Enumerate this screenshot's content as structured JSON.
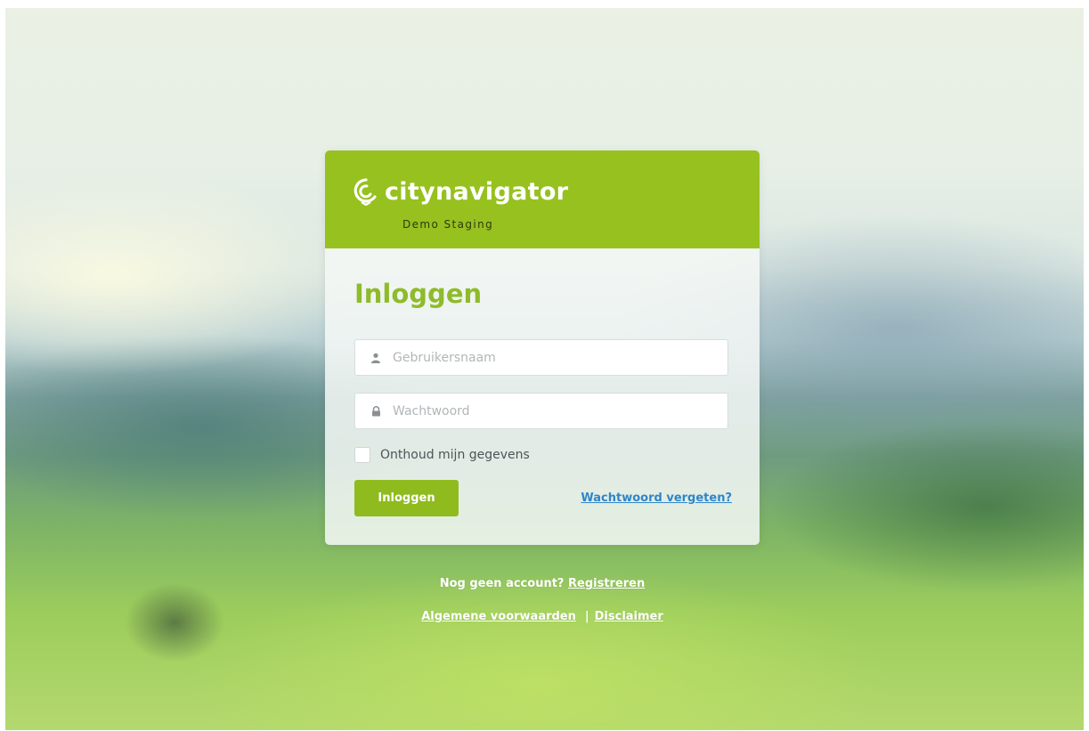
{
  "brand": {
    "name": "citynavigator",
    "subtitle": "Demo Staging",
    "icon": "citynavigator-logo-icon",
    "color": "#96c11f"
  },
  "login": {
    "heading": "Inloggen",
    "username_placeholder": "Gebruikersnaam",
    "username_icon": "user-icon",
    "password_placeholder": "Wachtwoord",
    "password_icon": "lock-icon",
    "remember_label": "Onthoud mijn gegevens",
    "remember_checked": false,
    "submit_label": "Inloggen",
    "forgot_label": "Wachtwoord vergeten?"
  },
  "footer": {
    "no_account_text": "Nog geen account?",
    "register_label": "Registreren",
    "terms_label": "Algemene voorwaarden",
    "separator": "|",
    "disclaimer_label": "Disclaimer"
  },
  "colors": {
    "accent": "#8fbb1f",
    "heading": "#8fbb2a",
    "link": "#2f86c9"
  }
}
